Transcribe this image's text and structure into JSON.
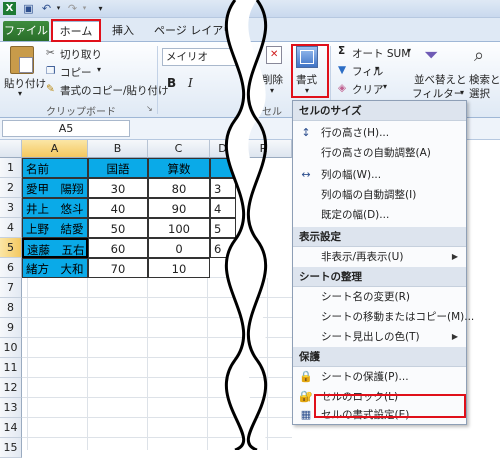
{
  "ribbon_tabs": {
    "file": "ファイル",
    "home": "ホーム",
    "insert": "挿入",
    "layout": "ページ レイアウト"
  },
  "clipboard": {
    "paste": "貼り付け",
    "cut": "切り取り",
    "copy": "コピー",
    "format_painter": "書式のコピー/貼り付け",
    "group_label": "クリップボード"
  },
  "font": {
    "name": "メイリオ",
    "bold": "B",
    "italic": "I"
  },
  "cells_group": {
    "delete": "削除",
    "format": "書式",
    "group_label": "セル"
  },
  "editing": {
    "autosum": "オート SUM",
    "fill": "フィル",
    "clear": "クリア",
    "sort_filter_1": "並べ替えと",
    "sort_filter_2": "フィルター",
    "find_1": "検索と",
    "find_2": "選択"
  },
  "formula_bar": {
    "name_box": "A5"
  },
  "columns": [
    "A",
    "B",
    "C",
    "D",
    "R"
  ],
  "rows": [
    "1",
    "2",
    "3",
    "4",
    "5",
    "6",
    "7",
    "8",
    "9",
    "10",
    "11",
    "12",
    "13",
    "14",
    "15"
  ],
  "table": [
    {
      "name": "名前",
      "b": "国語",
      "c": "算数",
      "d": ""
    },
    {
      "name": "愛甲　陽翔",
      "b": "30",
      "c": "80",
      "d": "3"
    },
    {
      "name": "井上　悠斗",
      "b": "40",
      "c": "90",
      "d": "4"
    },
    {
      "name": "上野　結愛",
      "b": "50",
      "c": "100",
      "d": "5"
    },
    {
      "name": "遠藤　五右",
      "b": "60",
      "c": "0",
      "d": "6"
    },
    {
      "name": "緒方　大和",
      "b": "70",
      "c": "10",
      "d": ""
    }
  ],
  "menu": {
    "sec_size": "セルのサイズ",
    "row_height": "行の高さ(H)...",
    "row_autofit": "行の高さの自動調整(A)",
    "col_width": "列の幅(W)...",
    "col_autofit": "列の幅の自動調整(I)",
    "default_width": "既定の幅(D)...",
    "sec_visibility": "表示設定",
    "hide_unhide": "非表示/再表示(U)",
    "sec_organize": "シートの整理",
    "rename": "シート名の変更(R)",
    "move_copy": "シートの移動またはコピー(M)...",
    "tab_color": "シート見出しの色(T)",
    "sec_protect": "保護",
    "protect_sheet": "シートの保護(P)...",
    "lock_cell": "セルのロック(L)",
    "format_cells": "セルの書式設定(E)..."
  },
  "colors": {
    "highlight": "#0aaae8",
    "callout": "#e0101a",
    "file_tab": "#2a6e2a"
  }
}
